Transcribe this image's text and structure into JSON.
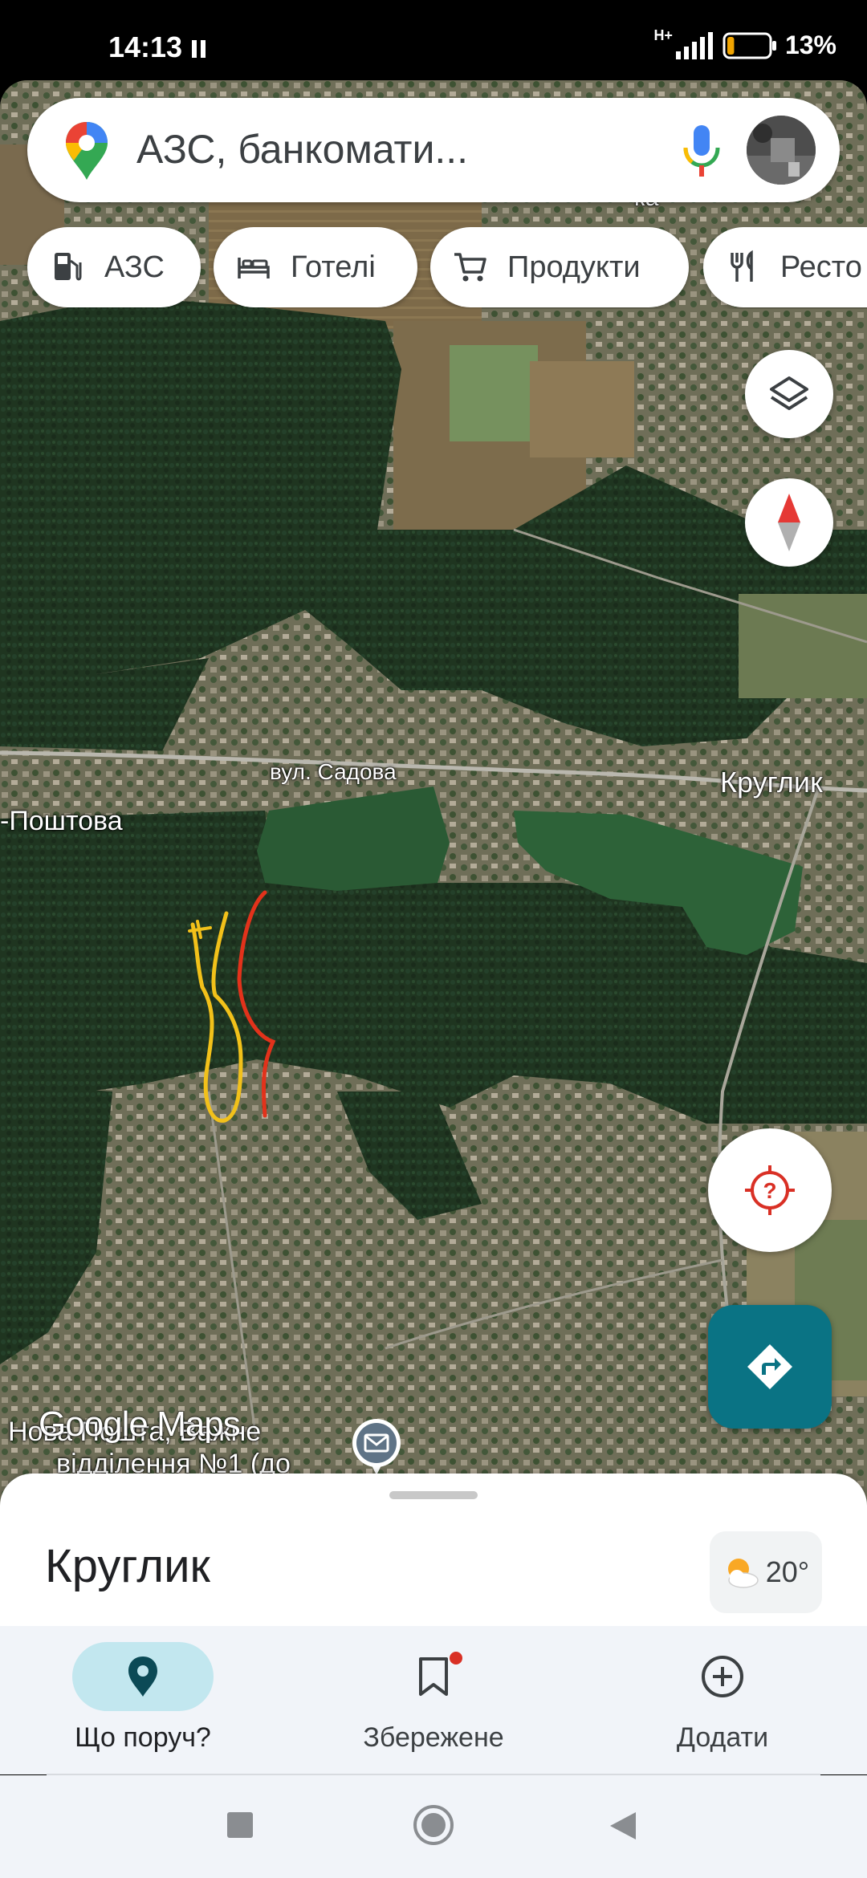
{
  "status_bar": {
    "time": "14:13",
    "network": "H+",
    "battery_percent": "13%",
    "battery_level": 0.13
  },
  "search": {
    "placeholder": "АЗС, банкомати..."
  },
  "chips": [
    {
      "label": "АЗС",
      "icon": "gas-station-icon"
    },
    {
      "label": "Готелі",
      "icon": "bed-icon"
    },
    {
      "label": "Продукти",
      "icon": "shopping-cart-icon"
    },
    {
      "label": "Ресто",
      "icon": "restaurant-icon"
    }
  ],
  "map_labels": {
    "street": "вул. Садова",
    "village": "Круглик",
    "poshtova": "Поштова",
    "post_office_line1": "Нова Пошта, Важне",
    "post_office_line2": "відділення №1 (до",
    "partial_top": "ка"
  },
  "logo": "Google Maps",
  "place": {
    "name": "Круглик",
    "temperature": "20°",
    "weather_icon": "partly-cloudy-icon"
  },
  "bottom_nav": [
    {
      "label": "Що поруч?",
      "icon": "location-pin-icon",
      "active": true
    },
    {
      "label": "Збережене",
      "icon": "bookmark-icon",
      "active": false,
      "badge": true
    },
    {
      "label": "Додати",
      "icon": "add-circle-icon",
      "active": false
    }
  ],
  "colors": {
    "accent": "#0a7384",
    "nav_active_pill": "#c2e7ef",
    "lake": "#2a5a34",
    "route_red": "#e2321b",
    "route_yellow": "#f2c11a"
  }
}
